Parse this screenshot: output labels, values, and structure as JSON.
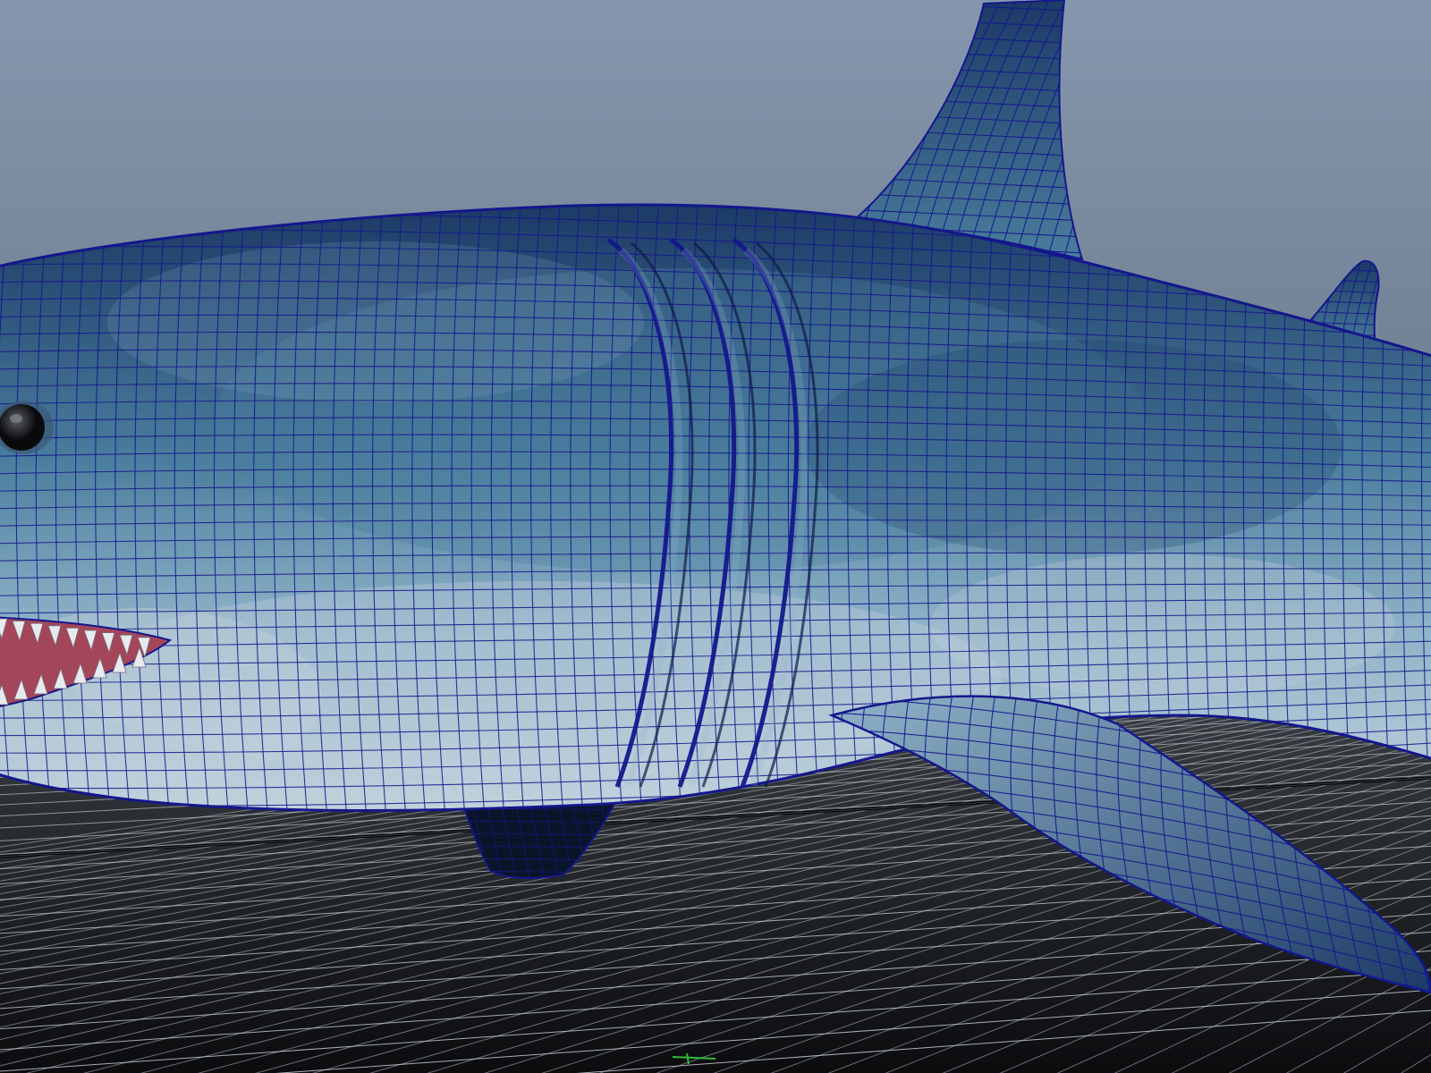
{
  "viewport": {
    "colors": {
      "sky_top": "#8597ad",
      "sky_bottom": "#4f5a68",
      "floor_near": "#0b0c0e",
      "floor_far": "#3a3f45",
      "grid_line": "#c7cdd4",
      "grid_axis": "#000000",
      "body_dark": "#1c3a66",
      "body_mid": "#4a7d9e",
      "body_light": "#8fb3c8",
      "belly": "#c2d2dc",
      "wire": "#14178c",
      "gum": "#a3465a",
      "tooth": "#e6eaee",
      "eye": "#0a0a0c",
      "view_axis_green": "#2dbb3a"
    },
    "icons": [
      "view-axis-icon"
    ]
  }
}
